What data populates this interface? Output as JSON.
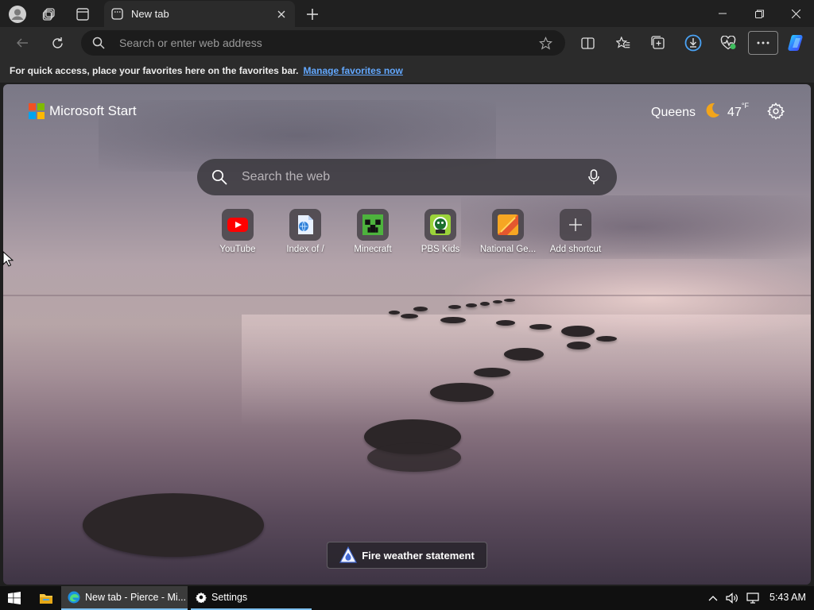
{
  "browser": {
    "tab": {
      "title": "New tab"
    },
    "address": {
      "placeholder": "Search or enter web address"
    },
    "favorites_bar": {
      "message": "For quick access, place your favorites here on the favorites bar.",
      "link": "Manage favorites now"
    },
    "icons": [
      "profile-icon",
      "workspaces-icon",
      "vertical-tabs-icon",
      "back-icon",
      "refresh-icon",
      "search-icon",
      "favorite-star-icon",
      "split-screen-icon",
      "favorites-icon",
      "collections-icon",
      "downloads-icon",
      "browser-essentials-icon",
      "more-icon",
      "copilot-icon"
    ]
  },
  "page": {
    "brand": "Microsoft Start",
    "brand_colors": [
      "#f25022",
      "#7fba00",
      "#00a4ef",
      "#ffb900"
    ],
    "weather": {
      "location": "Queens",
      "temp": "47",
      "unit": "°F"
    },
    "search": {
      "placeholder": "Search the web"
    },
    "shortcuts": [
      {
        "label": "YouTube"
      },
      {
        "label": "Index of /"
      },
      {
        "label": "Minecraft"
      },
      {
        "label": "PBS Kids"
      },
      {
        "label": "National Ge..."
      },
      {
        "label": "Add shortcut"
      }
    ],
    "alert": "Fire weather statement"
  },
  "taskbar": {
    "edge_item": "New tab - Pierce - Mi...",
    "settings_item": "Settings",
    "clock": "5:43 AM"
  }
}
